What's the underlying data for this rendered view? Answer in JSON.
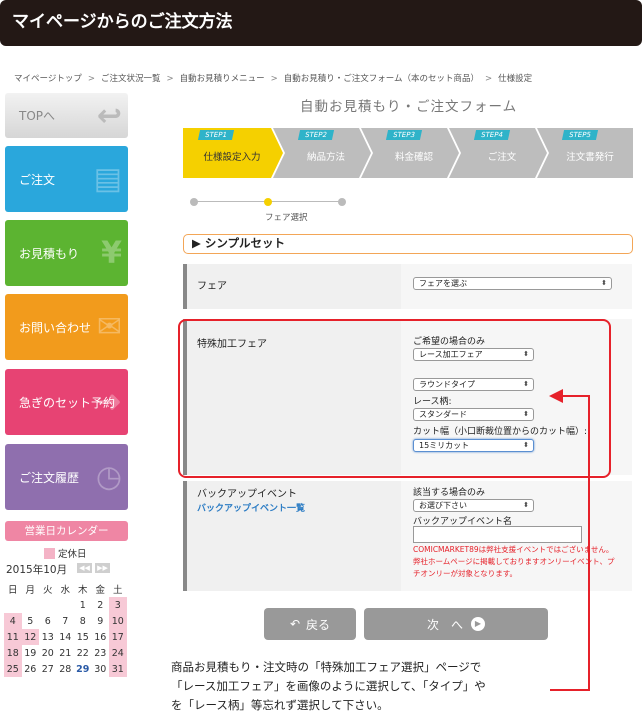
{
  "header": {
    "title": "マイページからのご注文方法"
  },
  "breadcrumb": [
    "マイページトップ",
    "ご注文状況一覧",
    "自動お見積りメニュー",
    "自動お見積り・ご注文フォーム（本のセット商品）",
    "仕様設定"
  ],
  "sidebar": {
    "top": "TOPへ",
    "order": "ご注文",
    "quote": "お見積もり",
    "inquiry": "お問い合わせ",
    "urgent": "急ぎのセット予約",
    "history": "ご注文履歴"
  },
  "calendar": {
    "title": "営業日カレンダー",
    "legend": "定休日",
    "month": "2015年10月",
    "weekdays": [
      "日",
      "月",
      "火",
      "水",
      "木",
      "金",
      "土"
    ],
    "weeks": [
      [
        "",
        "",
        "",
        "",
        "1",
        "2",
        "3"
      ],
      [
        "4",
        "5",
        "6",
        "7",
        "8",
        "9",
        "10"
      ],
      [
        "11",
        "12",
        "13",
        "14",
        "15",
        "16",
        "17"
      ],
      [
        "18",
        "19",
        "20",
        "21",
        "22",
        "23",
        "24"
      ],
      [
        "25",
        "26",
        "27",
        "28",
        "29",
        "30",
        "31"
      ]
    ],
    "colors": {
      "holiday": "#f7c9d6",
      "sunday": "#e74373",
      "header": "#ef86a4"
    }
  },
  "form": {
    "title": "自動お見積もり・ご注文フォーム",
    "steps": [
      {
        "tag": "STEP1",
        "label": "仕様設定入力"
      },
      {
        "tag": "STEP2",
        "label": "納品方法"
      },
      {
        "tag": "STEP3",
        "label": "料金確認"
      },
      {
        "tag": "STEP4",
        "label": "ご注文"
      },
      {
        "tag": "STEP5",
        "label": "注文書発行"
      }
    ],
    "progress_label": "フェア選択",
    "section": "シンプルセット",
    "fair": {
      "label": "フェア",
      "select": "フェアを選ぶ"
    },
    "special": {
      "label": "特殊加工フェア",
      "hint": "ご希望の場合のみ",
      "select1": "レース加工フェア",
      "select2": "ラウンドタイプ",
      "pattern_label": "レース柄:",
      "select3": "スタンダード",
      "cut_label": "カット幅（小口断裁位置からのカット幅）:",
      "select4": "15ミリカット"
    },
    "backup": {
      "label": "バックアップイベント",
      "link": "バックアップイベント一覧",
      "hint": "該当する場合のみ",
      "select": "お選び下さい",
      "name_label": "バックアップイベント名",
      "name_value": "",
      "note": "COMICMARKET89は弊社支援イベントではございません。弊社ホームページに掲載しておりますオンリーイベント、プチオンリーが対象となります。"
    },
    "back_button": "戻る",
    "next_button": "次　へ"
  },
  "annotation": {
    "line1": "商品お見積もり・注文時の「特殊加工フェア選択」ページで",
    "line2": "「レース加工フェア」を画像のように選択して、「タイプ」や",
    "line3": "を「レース柄」等忘れず選択して下さい。"
  },
  "colors": {
    "accent_red": "#e6212a",
    "step_active": "#f5d000",
    "step_inactive": "#bdbdbd"
  }
}
